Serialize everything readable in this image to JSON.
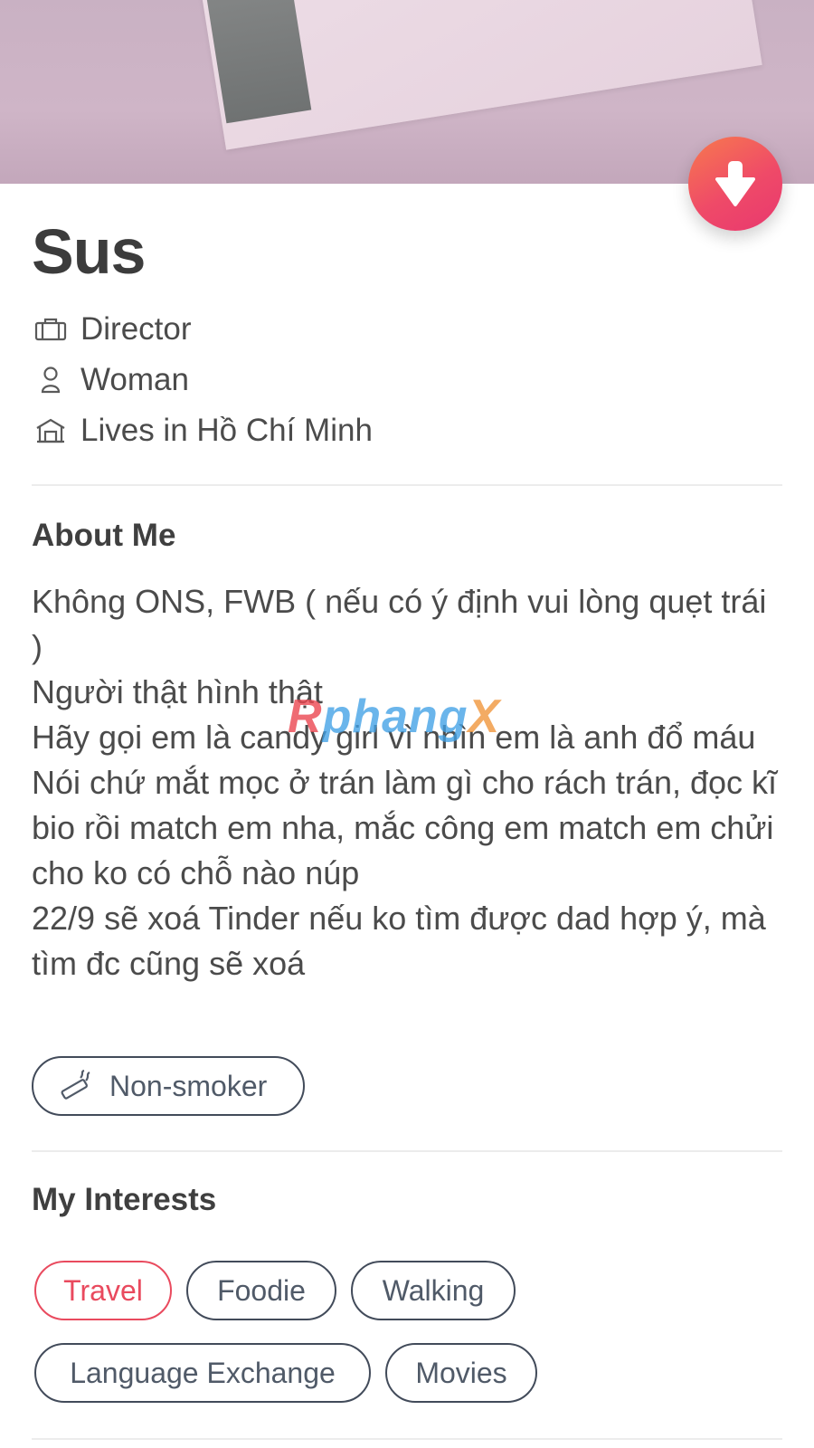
{
  "profile": {
    "name": "Sus",
    "job": "Director",
    "gender": "Woman",
    "location": "Lives in Hồ Chí Minh"
  },
  "about": {
    "title": "About Me",
    "lines": [
      "Không ONS, FWB ( nếu có ý định vui lòng quẹt trái )",
      "Người thật hình thật",
      "Hãy gọi em là candy girl vì nhìn em là anh đổ máu",
      "Nói chứ mắt mọc ở trán làm gì cho rách trán, đọc kĩ bio rồi match em nha, mắc công em match em chửi cho ko có chỗ nào núp",
      "22/9 sẽ xoá Tinder nếu ko tìm được dad hợp ý, mà tìm đc cũng sẽ xoá"
    ],
    "smoking": "Non-smoker"
  },
  "watermark": {
    "part1": "R",
    "part2": "phang",
    "part3": "X"
  },
  "interests": {
    "title": "My Interests",
    "items": [
      "Travel",
      "Foodie",
      "Walking",
      "Language Exchange",
      "Movies"
    ],
    "active": "Travel"
  },
  "colors": {
    "accent": "#e94a5e",
    "text": "#424242",
    "fab_gradient_start": "#f77a4e",
    "fab_gradient_end": "#e8386f"
  },
  "icons": {
    "collapse": "arrow-down-icon",
    "job": "briefcase-icon",
    "gender": "person-icon",
    "location": "home-icon",
    "smoking": "cigarette-icon"
  }
}
